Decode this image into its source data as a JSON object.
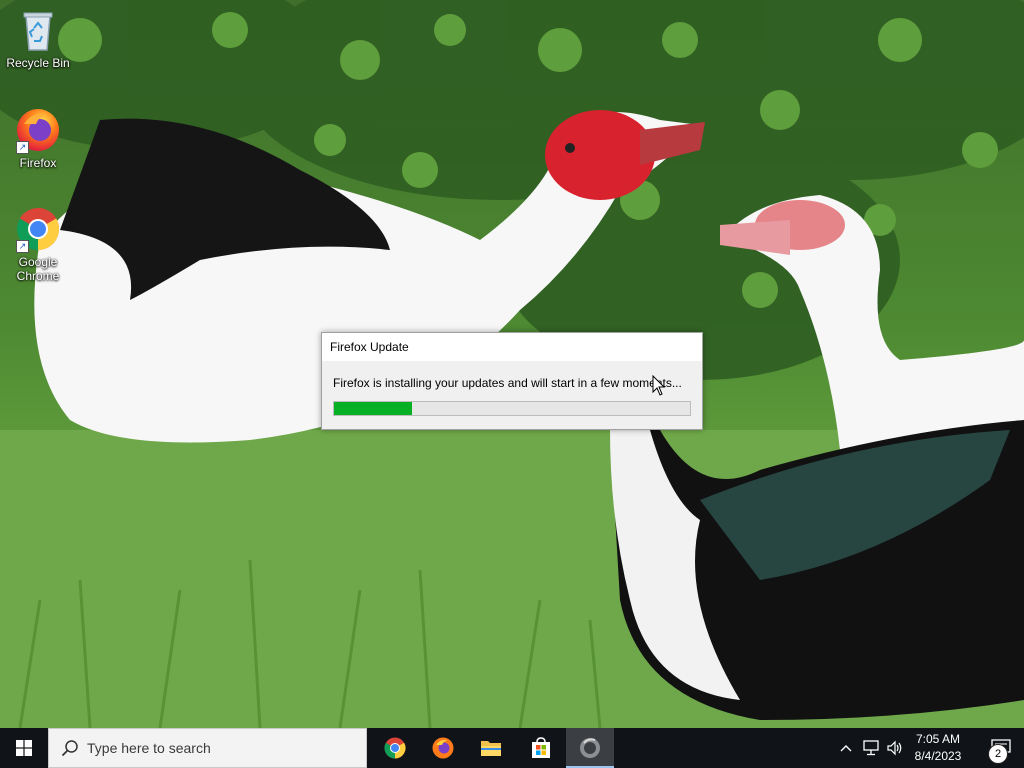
{
  "desktop": {
    "icons": [
      {
        "label": "Recycle Bin",
        "icon": "recycle-bin-icon"
      },
      {
        "label": "Firefox",
        "icon": "firefox-icon"
      },
      {
        "label": "Google Chrome",
        "icon": "chrome-icon"
      }
    ]
  },
  "dialog": {
    "title": "Firefox Update",
    "message": "Firefox is installing your updates and will start in a few moments...",
    "progress_fraction": 0.22,
    "progress_color": "#06b025"
  },
  "taskbar": {
    "search_placeholder": "Type here to search",
    "apps": [
      {
        "name": "Google Chrome",
        "icon": "chrome-icon"
      },
      {
        "name": "Firefox",
        "icon": "firefox-icon"
      },
      {
        "name": "File Explorer",
        "icon": "folder-icon"
      },
      {
        "name": "Microsoft Store",
        "icon": "store-icon"
      },
      {
        "name": "Firefox Update",
        "icon": "firefox-update-icon",
        "active": true
      }
    ],
    "tray_icons": [
      "chevron-up-icon",
      "network-icon",
      "volume-icon"
    ],
    "clock": {
      "time": "7:05 AM",
      "date": "8/4/2023"
    },
    "notifications_count": "2"
  }
}
